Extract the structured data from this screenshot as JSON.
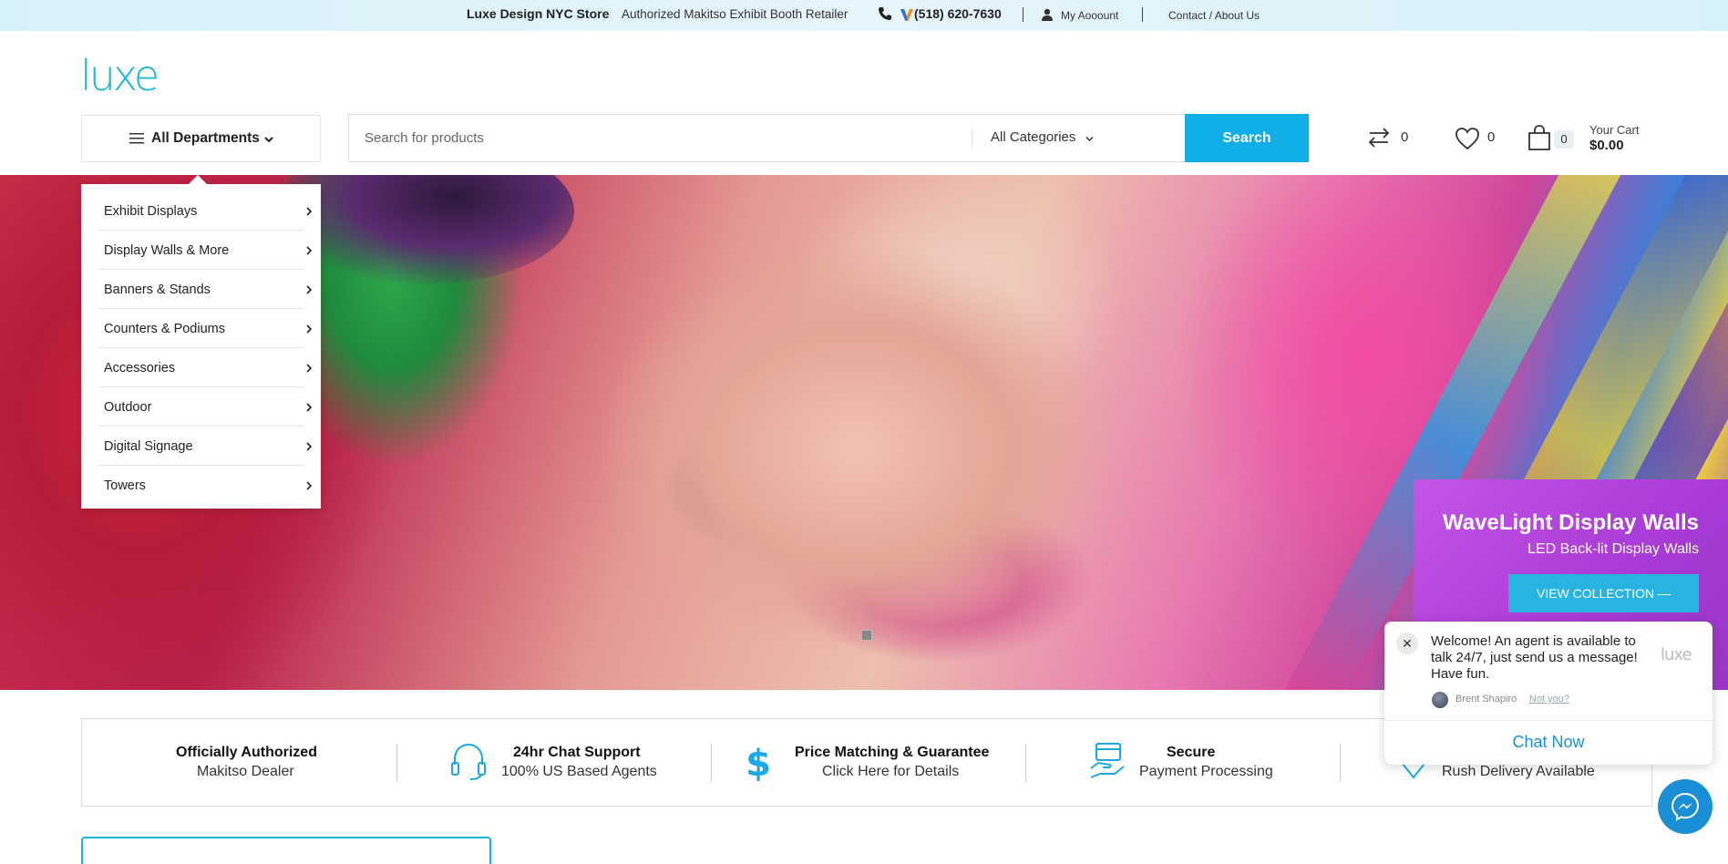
{
  "topbar": {
    "store_name": "Luxe Design NYC Store",
    "retailer": "Authorized Makitso Exhibit Booth Retailer",
    "phone": "(518) 620-7630",
    "account": "My Aooount",
    "contact": "Contact / About Us",
    "phone_icon": "phone-icon",
    "user_icon": "user-icon"
  },
  "brand": {
    "logo_text": "luxe",
    "color": "#1ab6d6"
  },
  "departments": {
    "label": "All Departments",
    "items": [
      {
        "label": "Exhibit Displays"
      },
      {
        "label": "Display Walls & More"
      },
      {
        "label": "Banners & Stands"
      },
      {
        "label": "Counters & Podiums"
      },
      {
        "label": "Accessories"
      },
      {
        "label": "Outdoor"
      },
      {
        "label": "Digital Signage"
      },
      {
        "label": "Towers"
      }
    ]
  },
  "search": {
    "placeholder": "Search for products",
    "value": "",
    "category": "All Categories",
    "button": "Search",
    "button_color": "#10aee6"
  },
  "header_actions": {
    "compare_count": "0",
    "wishlist_count": "0",
    "cart_count": "0",
    "cart_label": "Your Cart",
    "cart_total": "$0.00"
  },
  "hero": {
    "promo_title": "WaveLight Display Walls",
    "promo_subtitle": "LED Back-lit Display Walls",
    "promo_button": "VIEW COLLECTION —"
  },
  "chat": {
    "message": "Welcome! An agent is available to talk 24/7, just send us a message! Have fun.",
    "logo_text": "luxe",
    "agent_name": "Brent Shapiro",
    "not_you": "Not you?",
    "cta": "Chat Now",
    "close": "✕"
  },
  "features": [
    {
      "title": "Officially Authorized",
      "subtitle": "Makitso Dealer"
    },
    {
      "title": "24hr Chat Support",
      "subtitle": "100% US Based Agents",
      "icon": "headset-icon"
    },
    {
      "title": "Price Matching & Guarantee",
      "subtitle": "Click Here for Details",
      "icon": "dollar-icon"
    },
    {
      "title": "Secure",
      "subtitle": "Payment Processing",
      "icon": "secure-payment-icon"
    },
    {
      "title": "",
      "subtitle": "Rush Delivery Available",
      "icon": "delivery-icon"
    }
  ]
}
